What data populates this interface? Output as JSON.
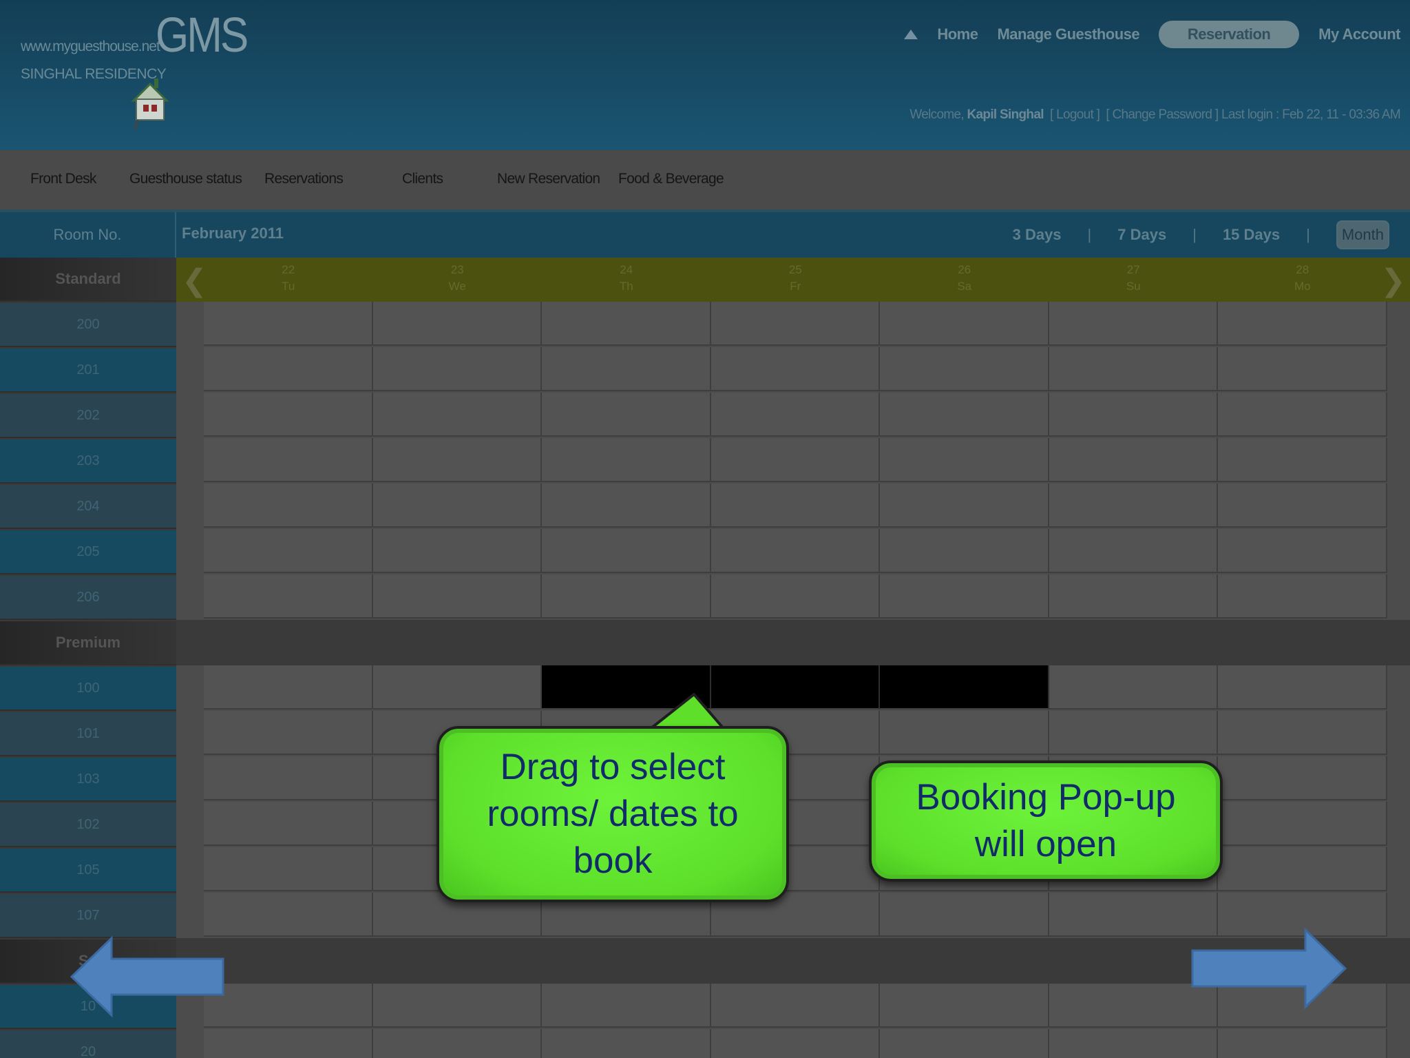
{
  "header": {
    "site_url": "www.myguesthouse.net",
    "site_name": "SINGHAL RESIDENCY",
    "logo": "GMS",
    "nav": [
      {
        "label": "Home"
      },
      {
        "label": "Manage Guesthouse"
      },
      {
        "label": "Reservation",
        "active": true
      },
      {
        "label": "My Account"
      }
    ],
    "welcome_prefix": "Welcome,",
    "user_name": "Kapil Singhal",
    "logout": "[ Logout ]",
    "change_password": "[ Change Password ]",
    "last_login": "Last login : Feb 22, 11 - 03:36 AM"
  },
  "menu": [
    {
      "label": "Front Desk"
    },
    {
      "label": "Guesthouse status"
    },
    {
      "label": "Reservations"
    },
    {
      "label": "Clients"
    },
    {
      "label": "New Reservation"
    },
    {
      "label": "Food & Beverage"
    }
  ],
  "toolbar": {
    "room_header": "Room No.",
    "month": "February 2011",
    "views": [
      "3 Days",
      "7 Days",
      "15 Days",
      "Month"
    ],
    "separator": "|",
    "active_view": "Month"
  },
  "days": [
    {
      "num": "22",
      "dow": "Tu"
    },
    {
      "num": "23",
      "dow": "We"
    },
    {
      "num": "24",
      "dow": "Th"
    },
    {
      "num": "25",
      "dow": "Fr"
    },
    {
      "num": "26",
      "dow": "Sa"
    },
    {
      "num": "27",
      "dow": "Su"
    },
    {
      "num": "28",
      "dow": "Mo"
    }
  ],
  "rows": [
    {
      "label": "Standard",
      "type": "category"
    },
    {
      "label": "200",
      "type": "room"
    },
    {
      "label": "201",
      "type": "room"
    },
    {
      "label": "202",
      "type": "room"
    },
    {
      "label": "203",
      "type": "room"
    },
    {
      "label": "204",
      "type": "room"
    },
    {
      "label": "205",
      "type": "room"
    },
    {
      "label": "206",
      "type": "room"
    },
    {
      "label": "Premium",
      "type": "category"
    },
    {
      "label": "100",
      "type": "room",
      "selected_days": [
        2,
        3,
        4
      ]
    },
    {
      "label": "101",
      "type": "room"
    },
    {
      "label": "103",
      "type": "room"
    },
    {
      "label": "102",
      "type": "room"
    },
    {
      "label": "105",
      "type": "room"
    },
    {
      "label": "107",
      "type": "room"
    },
    {
      "label": "Su",
      "type": "category"
    },
    {
      "label": "10",
      "type": "room"
    },
    {
      "label": "20",
      "type": "room"
    }
  ],
  "callouts": {
    "drag": [
      "Drag to select",
      "rooms/ dates to",
      "book"
    ],
    "popup": [
      "Booking Pop-up",
      "will open"
    ]
  },
  "colors": {
    "callout_green": "#5ee02a",
    "callout_text": "#112a6a",
    "arrow_blue": "#4f81bd",
    "selection": "#000000"
  },
  "icons": {
    "prev": "chevron-left-icon",
    "next": "chevron-right-icon",
    "back_arrow": "arrow-left-icon",
    "forward_arrow": "arrow-right-icon"
  }
}
